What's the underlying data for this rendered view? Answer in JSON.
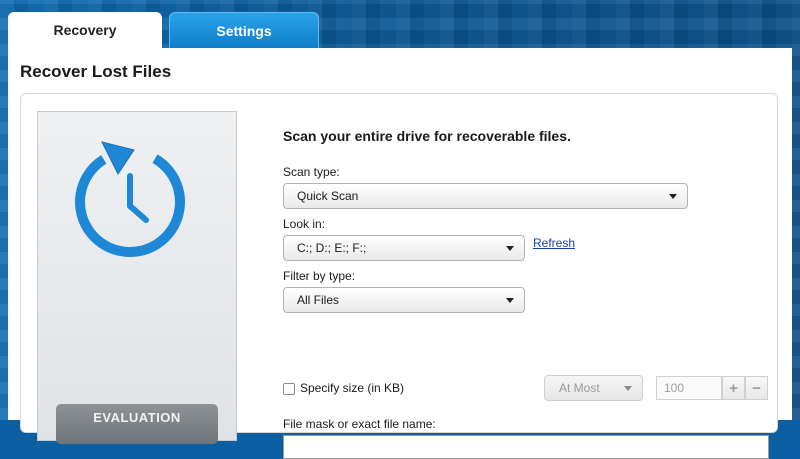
{
  "tabs": [
    {
      "label": "Recovery",
      "active": true
    },
    {
      "label": "Settings",
      "active": false
    }
  ],
  "page_title": "Recover Lost Files",
  "side_panel": {
    "icon": "restore-clock-icon",
    "badge": "EVALUATION"
  },
  "form": {
    "heading": "Scan your entire drive for recoverable files.",
    "scan_type": {
      "label": "Scan type:",
      "value": "Quick Scan"
    },
    "look_in": {
      "label": "Look in:",
      "value": "C:; D:; E:; F:;",
      "refresh": "Refresh"
    },
    "filter": {
      "label": "Filter by type:",
      "value": "All Files"
    },
    "size": {
      "label": "Specify size (in KB)",
      "checked": false,
      "mode": "At Most",
      "placeholder": "100",
      "plus": "+",
      "minus": "−"
    },
    "mask": {
      "label": "File mask or exact file name:",
      "value": ""
    }
  },
  "colors": {
    "accent": "#1e88d6",
    "link": "#1a3fa8",
    "header_bg": "#0d5fa3"
  }
}
